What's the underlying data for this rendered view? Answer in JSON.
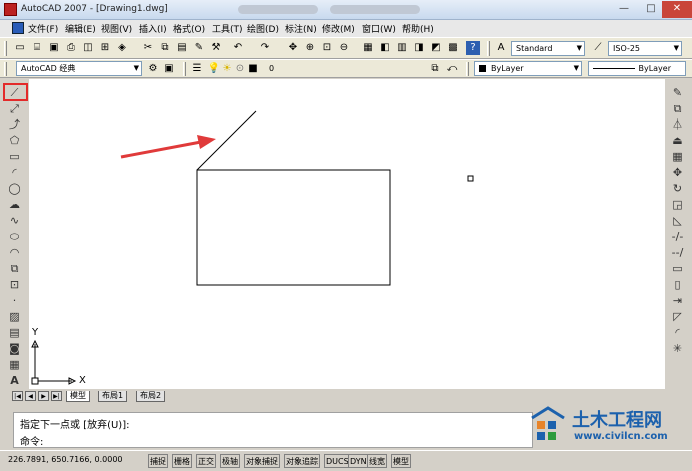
{
  "window": {
    "title": "AutoCAD 2007 - [Drawing1.dwg]",
    "minimize_glyph": "—",
    "maximize_glyph": "□",
    "close_glyph": "✕"
  },
  "menu": [
    "文件(F)",
    "编辑(E)",
    "视图(V)",
    "插入(I)",
    "格式(O)",
    "工具(T)",
    "绘图(D)",
    "标注(N)",
    "修改(M)",
    "窗口(W)",
    "帮助(H)"
  ],
  "toolbar": {
    "text_style": "Standard",
    "dim_style": "ISO-25",
    "workspace": "AutoCAD 经典",
    "layer": "0",
    "color": "ByLayer",
    "linetype": "ByLayer"
  },
  "layout_tabs": [
    "模型",
    "布局1",
    "布局2"
  ],
  "active_tab": "模型",
  "ucs": {
    "x_label": "X",
    "y_label": "Y"
  },
  "command": {
    "line1": "指定下一点或 [放弃(U)]:",
    "line2": "命令:"
  },
  "status": {
    "coordinates": "226.7891, 650.7166, 0.0000",
    "buttons": [
      "捕捉",
      "栅格",
      "正交",
      "极轴",
      "对象捕捉",
      "对象追踪",
      "DUCS",
      "DYN",
      "线宽",
      "模型"
    ]
  },
  "watermark": {
    "title": "土木工程网",
    "url": "www.civilcn.com"
  },
  "annotation": {
    "highlight_color": "#e32a2a",
    "arrow_color": "#e03a3a"
  },
  "icons": {
    "left": [
      "line-icon",
      "construction-line-icon",
      "polyline-icon",
      "polygon-icon",
      "rectangle-icon",
      "arc-icon",
      "circle-icon",
      "revision-cloud-icon",
      "spline-icon",
      "ellipse-icon",
      "ellipse-arc-icon",
      "insert-block-icon",
      "make-block-icon",
      "point-icon",
      "hatch-icon",
      "gradient-icon",
      "region-icon",
      "table-icon",
      "multiline-text-icon"
    ],
    "right": [
      "erase-icon",
      "copy-icon",
      "mirror-icon",
      "offset-icon",
      "array-icon",
      "move-icon",
      "rotate-icon",
      "scale-icon",
      "stretch-icon",
      "trim-icon",
      "extend-icon",
      "break-at-point-icon",
      "break-icon",
      "join-icon",
      "chamfer-icon",
      "fillet-icon",
      "explode-icon"
    ]
  }
}
